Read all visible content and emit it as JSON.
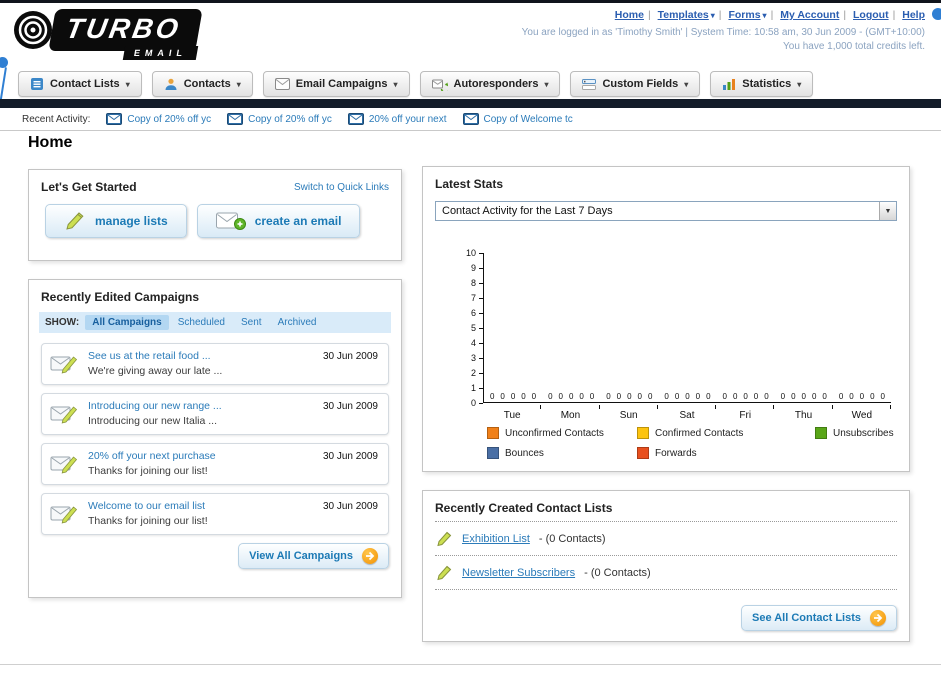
{
  "header": {
    "logo_text": "TURBO",
    "logo_sub": "EMAIL",
    "nav_links": [
      "Home",
      "Templates",
      "Forms",
      "My Account",
      "Logout",
      "Help"
    ],
    "login_status": "You are logged in as 'Timothy Smith' | System Time: 10:58 am, 30 Jun 2009 - (GMT+10:00)",
    "credits": "You have 1,000 total credits left."
  },
  "main_nav": {
    "tabs": [
      {
        "label": "Contact Lists"
      },
      {
        "label": "Contacts"
      },
      {
        "label": "Email Campaigns"
      },
      {
        "label": "Autoresponders"
      },
      {
        "label": "Custom Fields"
      },
      {
        "label": "Statistics"
      }
    ]
  },
  "recent_activity": {
    "label": "Recent Activity:",
    "items": [
      {
        "text": "Copy of 20% off yc"
      },
      {
        "text": "Copy of 20% off yc"
      },
      {
        "text": "20% off your next"
      },
      {
        "text": "Copy of Welcome tc"
      }
    ]
  },
  "page": {
    "title": "Home"
  },
  "get_started": {
    "title": "Let's Get Started",
    "switch_link": "Switch to Quick Links",
    "manage_lists_label": "manage lists",
    "create_email_label": "create an email"
  },
  "campaigns": {
    "title": "Recently Edited Campaigns",
    "show_label": "SHOW:",
    "tabs": [
      "All Campaigns",
      "Scheduled",
      "Sent",
      "Archived"
    ],
    "selected_tab": "All Campaigns",
    "items": [
      {
        "title": "See us at the retail food ...",
        "subtitle": "We're giving away our late ...",
        "date": "30 Jun 2009"
      },
      {
        "title": "Introducing our new range ...",
        "subtitle": "Introducing our new Italia ...",
        "date": "30 Jun 2009"
      },
      {
        "title": "20% off your next purchase",
        "subtitle": "Thanks for joining our list!",
        "date": "30 Jun 2009"
      },
      {
        "title": "Welcome to our email list",
        "subtitle": "Thanks for joining our list!",
        "date": "30 Jun 2009"
      }
    ],
    "view_all_label": "View All Campaigns"
  },
  "stats": {
    "title": "Latest Stats",
    "period_selector": "Contact Activity for the Last 7 Days",
    "chart_data": {
      "type": "bar",
      "categories": [
        "Tue",
        "Mon",
        "Sun",
        "Sat",
        "Fri",
        "Thu",
        "Wed"
      ],
      "series": [
        {
          "name": "Unconfirmed Contacts",
          "color": "#f08019",
          "values": [
            0,
            0,
            0,
            0,
            0,
            0,
            0
          ]
        },
        {
          "name": "Confirmed Contacts",
          "color": "#fdc40f",
          "values": [
            0,
            0,
            0,
            0,
            0,
            0,
            0
          ]
        },
        {
          "name": "Unsubscribes",
          "color": "#59a618",
          "values": [
            0,
            0,
            0,
            0,
            0,
            0,
            0
          ]
        },
        {
          "name": "Bounces",
          "color": "#4a6fa5",
          "values": [
            0,
            0,
            0,
            0,
            0,
            0,
            0
          ]
        },
        {
          "name": "Forwards",
          "color": "#e8501e",
          "values": [
            0,
            0,
            0,
            0,
            0,
            0,
            0
          ]
        }
      ],
      "ylim": [
        0,
        10
      ],
      "ytick_step": 1,
      "grid": false,
      "legend_position": "bottom"
    }
  },
  "contact_lists": {
    "title": "Recently Created Contact Lists",
    "items": [
      {
        "name": "Exhibition List",
        "suffix": "- (0 Contacts)"
      },
      {
        "name": "Newsletter Subscribers",
        "suffix": "- (0 Contacts)"
      }
    ],
    "see_all_label": "See All Contact Lists"
  }
}
